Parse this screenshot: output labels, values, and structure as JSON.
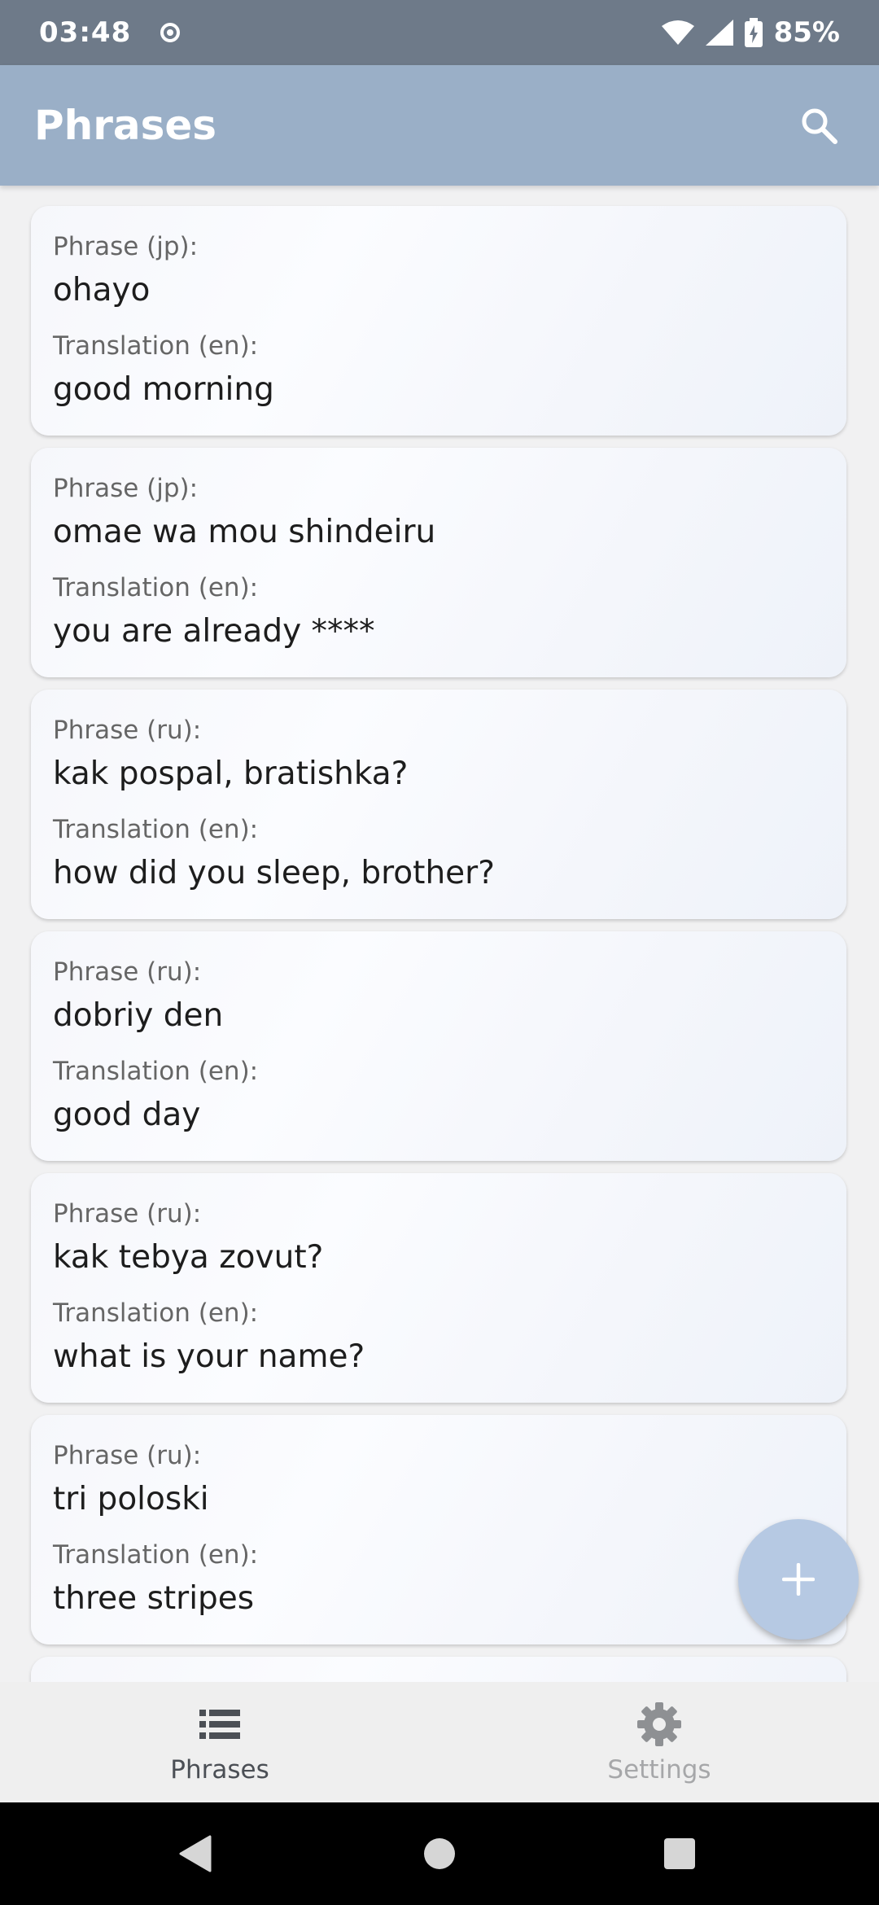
{
  "status": {
    "time": "03:48",
    "battery": "85%"
  },
  "appbar": {
    "title": "Phrases",
    "search_icon": "search-icon"
  },
  "phrases": [
    {
      "phrase_label": "Phrase (jp):",
      "phrase": "ohayo",
      "translation_label": "Translation (en):",
      "translation": "good morning"
    },
    {
      "phrase_label": "Phrase (jp):",
      "phrase": "omae wa mou shindeiru",
      "translation_label": "Translation (en):",
      "translation": "you are already ****"
    },
    {
      "phrase_label": "Phrase (ru):",
      "phrase": "kak pospal, bratishka?",
      "translation_label": "Translation (en):",
      "translation": "how did you sleep, brother?"
    },
    {
      "phrase_label": "Phrase (ru):",
      "phrase": "dobriy den",
      "translation_label": "Translation (en):",
      "translation": "good day"
    },
    {
      "phrase_label": "Phrase (ru):",
      "phrase": "kak tebya zovut?",
      "translation_label": "Translation (en):",
      "translation": "what is your name?"
    },
    {
      "phrase_label": "Phrase (ru):",
      "phrase": "tri poloski",
      "translation_label": "Translation (en):",
      "translation": "three stripes"
    }
  ],
  "fab": {
    "icon": "plus-icon"
  },
  "bottom_nav": {
    "items": [
      {
        "label": "Phrases",
        "icon": "list-icon",
        "active": true
      },
      {
        "label": "Settings",
        "icon": "gear-icon",
        "active": false
      }
    ]
  },
  "colors": {
    "status_bar": "#6e7a89",
    "app_bar": "#9aafc7",
    "fab": "#b6c9e3",
    "background": "#f1f1f2"
  }
}
